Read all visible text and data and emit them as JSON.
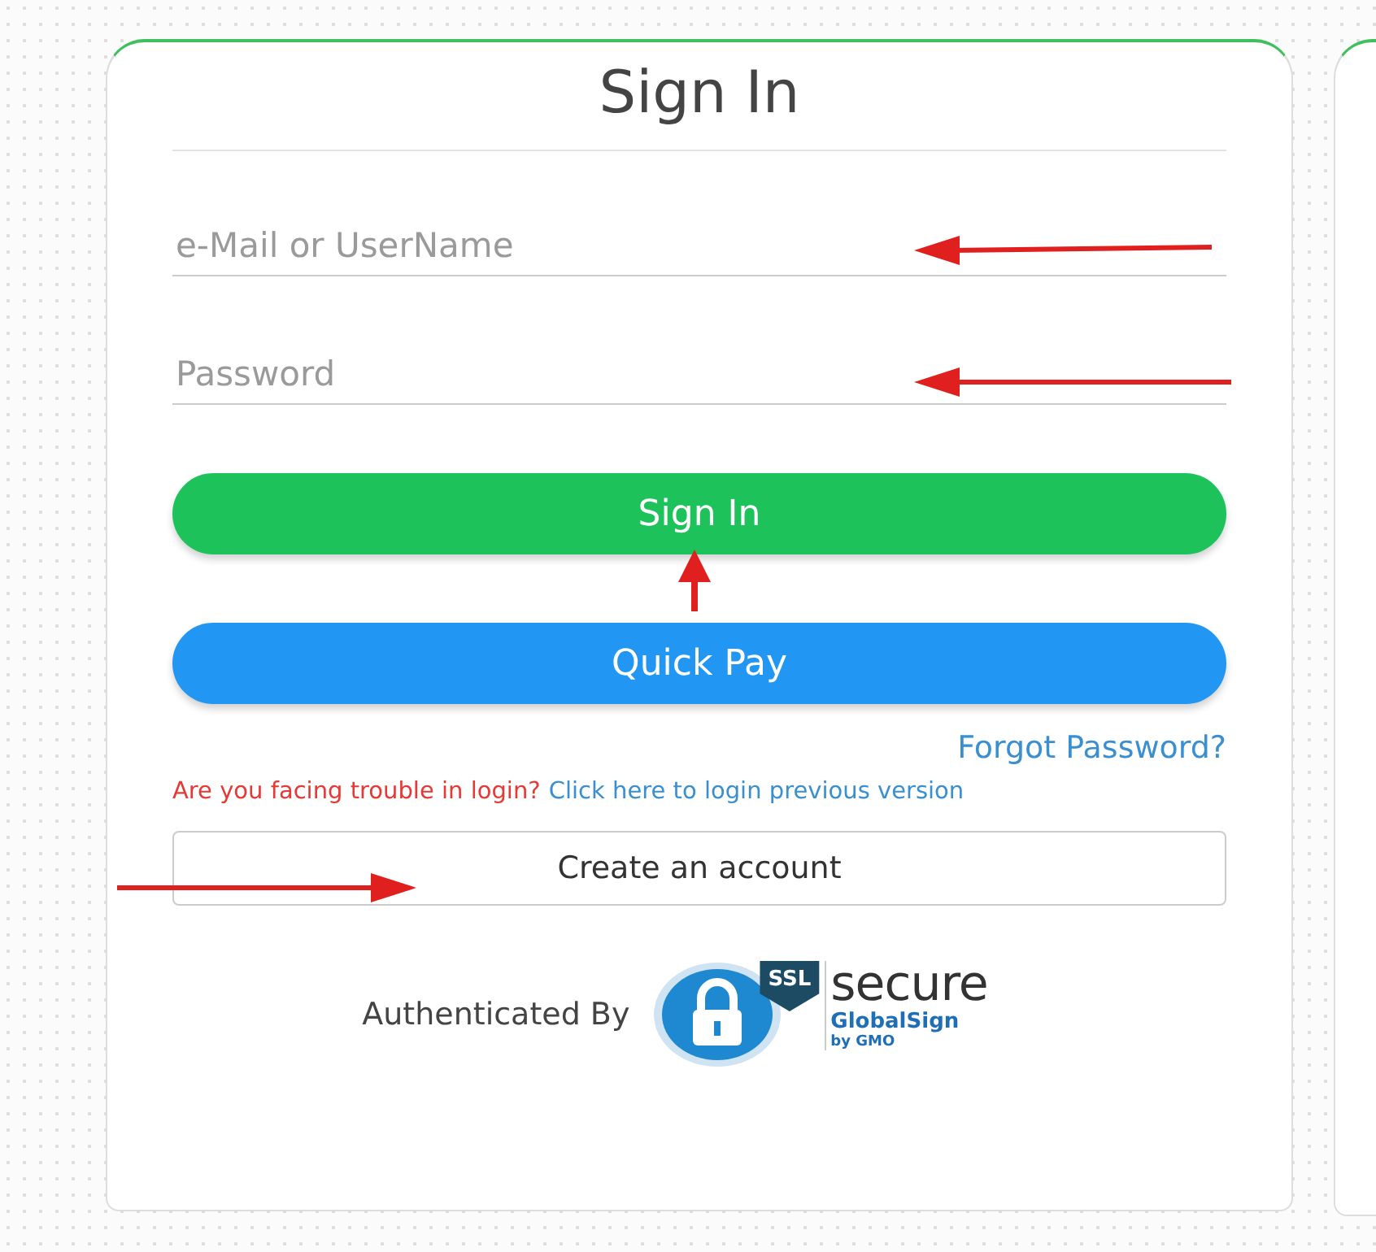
{
  "title": "Sign In",
  "fields": [
    {
      "placeholder": "e-Mail or UserName"
    },
    {
      "placeholder": "Password"
    }
  ],
  "buttons": [
    {
      "label": "Sign In",
      "kind": "primary"
    },
    {
      "label": "Quick Pay",
      "kind": "secondary"
    }
  ],
  "forgot_link": "Forgot Password?",
  "trouble": {
    "message": "Are you facing trouble in login?",
    "link": "Click here to login previous version"
  },
  "create_account": "Create an account",
  "authenticated": {
    "label": "Authenticated By",
    "badge": "SSL",
    "secure": "secure",
    "brand": "GlobalSign",
    "by": "by GMO"
  }
}
